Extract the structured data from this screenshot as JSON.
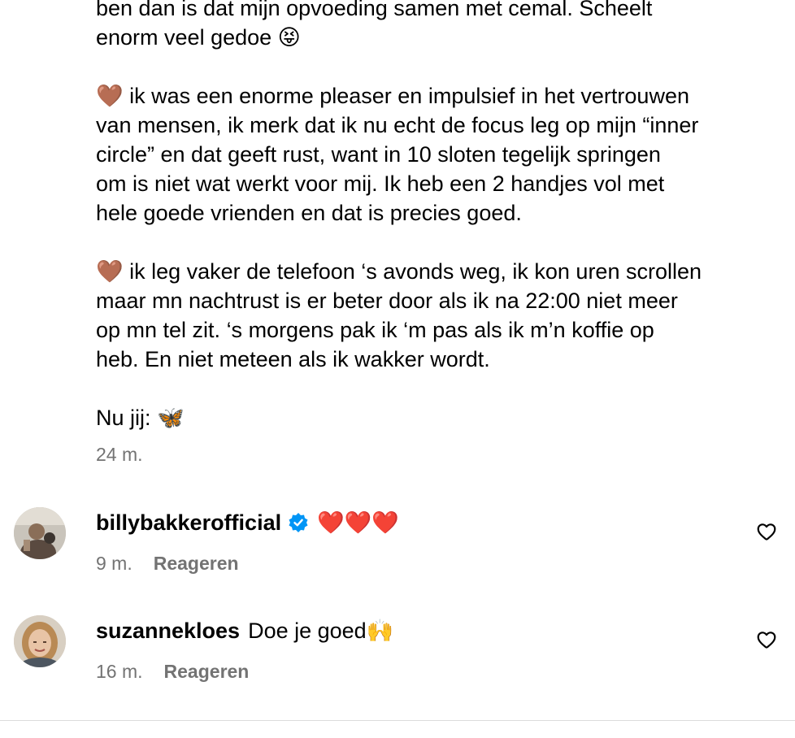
{
  "caption": {
    "lines_1": [
      "ben dan is dat mijn opvoeding samen met cemal. Scheelt",
      "enorm veel gedoe 😝"
    ],
    "lines_2": [
      "🤎 ik was een enorme pleaser en impulsief in het vertrouwen",
      "van mensen, ik merk dat ik nu echt de focus leg op mijn “inner",
      "circle” en dat geeft rust, want in 10 sloten tegelijk springen",
      "om is niet wat werkt voor mij. Ik heb een 2 handjes vol met",
      "hele goede vrienden en dat is precies goed."
    ],
    "lines_3": [
      "🤎 ik leg vaker de telefoon ‘s avonds weg, ik kon uren scrollen",
      "maar mn nachtrust is er beter door als ik na 22:00 niet meer",
      "op mn tel zit. ‘s morgens pak ik ‘m pas als ik m’n koffie op",
      "heb. En niet meteen als ik wakker wordt."
    ],
    "lines_4": [
      "Nu jij: 🦋"
    ],
    "time": "24 m."
  },
  "comments": [
    {
      "username": "billybakkerofficial",
      "verified": true,
      "text": "❤️❤️❤️",
      "time": "9 m.",
      "reply_label": "Reageren"
    },
    {
      "username": "suzannekloes",
      "verified": false,
      "text": "Doe je goed🙌",
      "time": "16 m.",
      "reply_label": "Reageren"
    }
  ],
  "colors": {
    "meta_text": "#737373",
    "verified_badge": "#0095f6",
    "divider": "#dbdbdb"
  }
}
